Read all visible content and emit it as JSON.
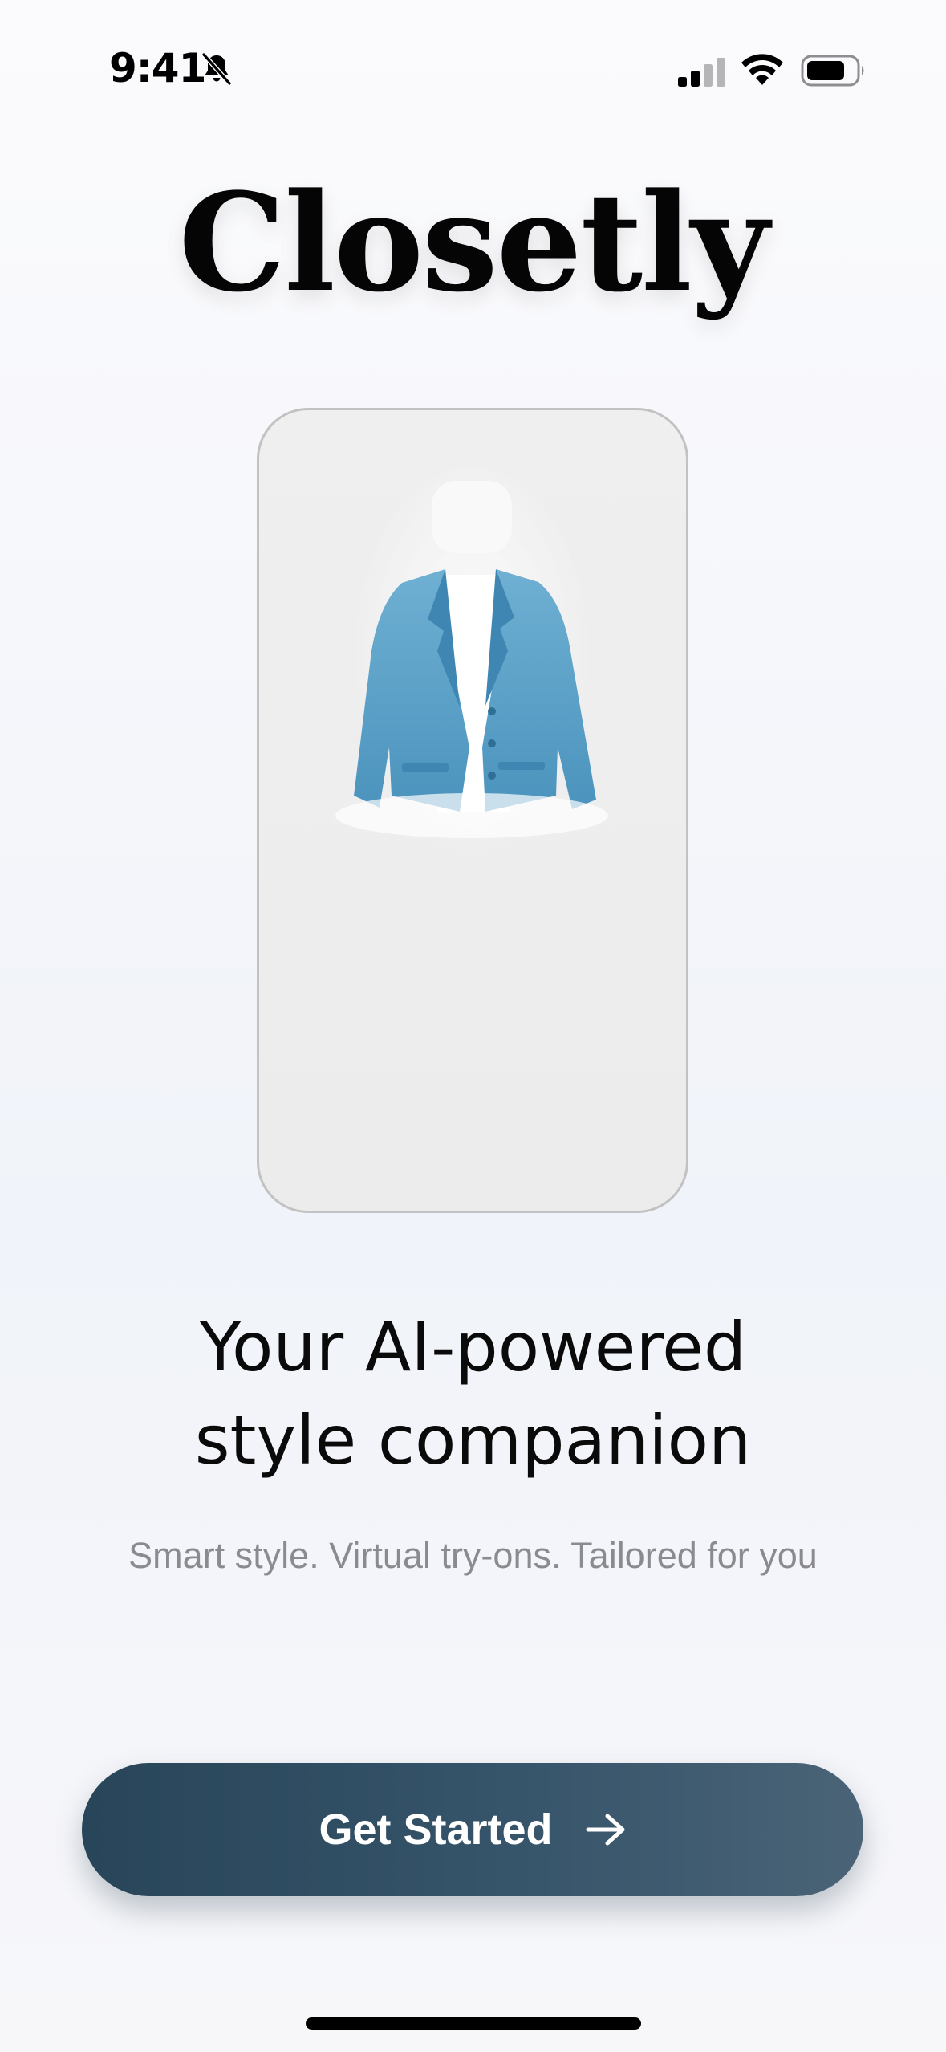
{
  "status_bar": {
    "time": "9:41",
    "icons": [
      "bell-slash-icon",
      "cellular-signal-icon",
      "wifi-icon",
      "battery-icon"
    ]
  },
  "brand": {
    "title": "Closetly"
  },
  "preview": {
    "image": "blue-jacket-icon"
  },
  "headline": {
    "line1": "Your AI-powered",
    "line2": "style companion"
  },
  "subtitle": "Smart style. Virtual try-ons. Tailored for you",
  "cta": {
    "label": "Get Started",
    "icon": "arrow-right-icon"
  },
  "colors": {
    "cta_start": "#284559",
    "cta_end": "#4a6377",
    "subtitle": "#8b8b8f",
    "jacket": "#5aa2c8"
  }
}
